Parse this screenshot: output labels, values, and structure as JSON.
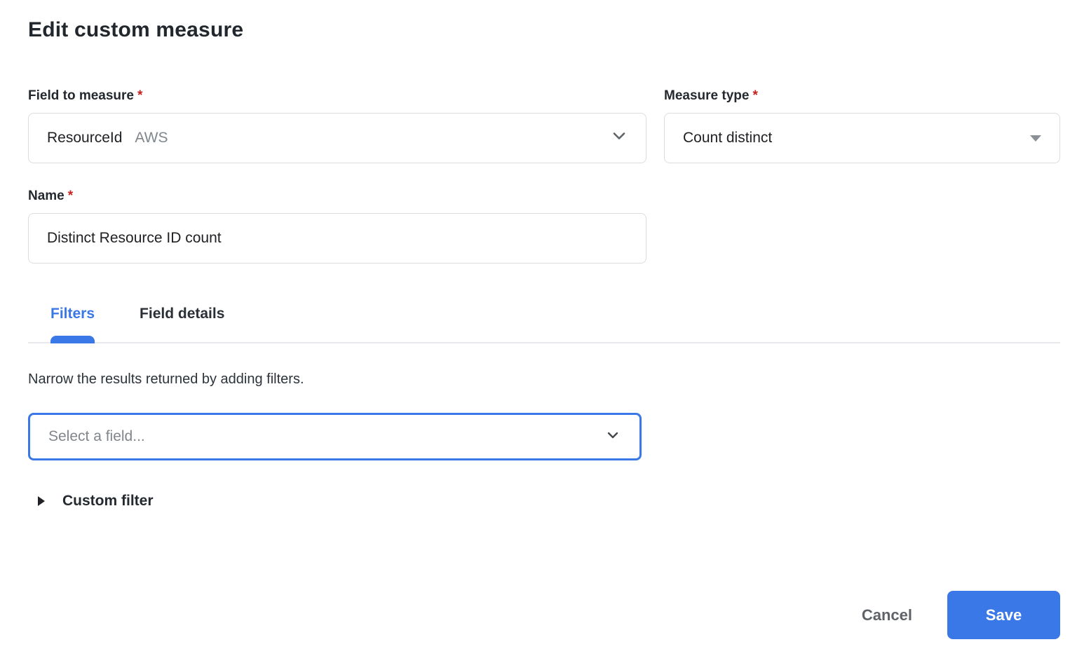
{
  "page": {
    "title": "Edit custom measure"
  },
  "form": {
    "field_to_measure": {
      "label": "Field to measure",
      "required_mark": "*",
      "value": "ResourceId",
      "value_tag": "AWS"
    },
    "measure_type": {
      "label": "Measure type",
      "required_mark": "*",
      "value": "Count distinct"
    },
    "name": {
      "label": "Name",
      "required_mark": "*",
      "value": "Distinct Resource ID count"
    }
  },
  "tabs": [
    {
      "label": "Filters",
      "active": true
    },
    {
      "label": "Field details",
      "active": false
    }
  ],
  "filters": {
    "description": "Narrow the results returned by adding filters.",
    "field_select": {
      "placeholder": "Select a field..."
    },
    "custom_filter": {
      "label": "Custom filter"
    }
  },
  "actions": {
    "cancel": "Cancel",
    "save": "Save"
  },
  "icons": {
    "field_dropdown": "chevron-down-icon",
    "measure_dropdown": "triangle-down-icon",
    "filter_dropdown": "chevron-down-icon",
    "custom_filter": "triangle-right-icon"
  },
  "colors": {
    "accent_blue": "#3b78e7",
    "required_red": "#c5221f",
    "input_border": "#dadce0",
    "muted_text": "#80868b",
    "text_dark": "#202124"
  }
}
